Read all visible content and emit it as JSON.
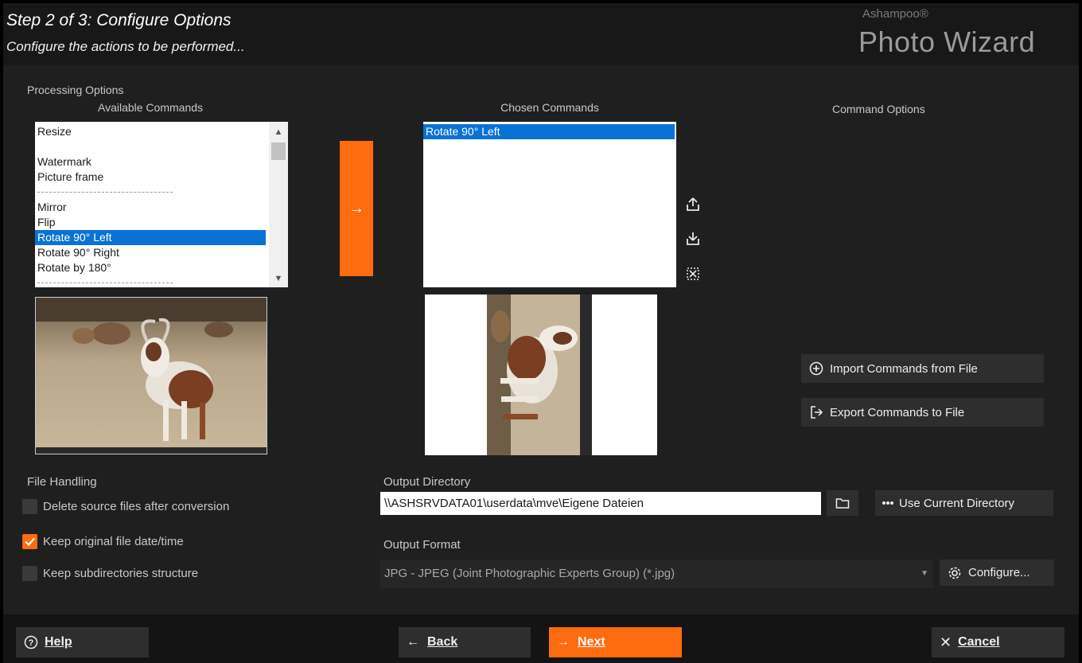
{
  "header": {
    "title": "Step 2 of 3: Configure Options",
    "subtitle": "Configure the actions to be performed...",
    "brand_small": "Ashampoo®",
    "brand_big": "Photo Wizard"
  },
  "processing": {
    "section_label": "Processing Options",
    "available_label": "Available Commands",
    "chosen_label": "Chosen Commands",
    "options_label": "Command Options",
    "available_items": [
      "Resize",
      "",
      "Watermark",
      "Picture frame",
      "-",
      "Mirror",
      "Flip",
      "Rotate 90° Left",
      "Rotate 90° Right",
      "Rotate by 180°",
      "-"
    ],
    "available_selected_index": 7,
    "chosen_items": [
      "Rotate 90° Left"
    ],
    "add_button": "→",
    "import_button": "Import Commands from File",
    "export_button": "Export Commands to File",
    "icons": {
      "move_up": "upload-icon",
      "move_down": "download-icon",
      "remove": "delete-icon"
    }
  },
  "file_handling": {
    "label": "File Handling",
    "options": [
      {
        "label": "Delete source files after conversion",
        "checked": false
      },
      {
        "label": "Keep original file date/time",
        "checked": true
      },
      {
        "label": "Keep subdirectories structure",
        "checked": false
      }
    ]
  },
  "output": {
    "dir_label": "Output Directory",
    "dir_value": "\\\\ASHSRVDATA01\\userdata\\mve\\Eigene Dateien",
    "use_current": "Use Current Directory",
    "format_label": "Output Format",
    "format_value": "JPG - JPEG (Joint Photographic Experts Group) (*.jpg)",
    "configure": "Configure..."
  },
  "footer": {
    "help": "Help",
    "back": "Back",
    "next": "Next",
    "cancel": "Cancel"
  },
  "colors": {
    "accent": "#ff6b0f",
    "selection": "#0a72d4",
    "background": "#1f1f1f",
    "button": "#2e2e2e"
  }
}
